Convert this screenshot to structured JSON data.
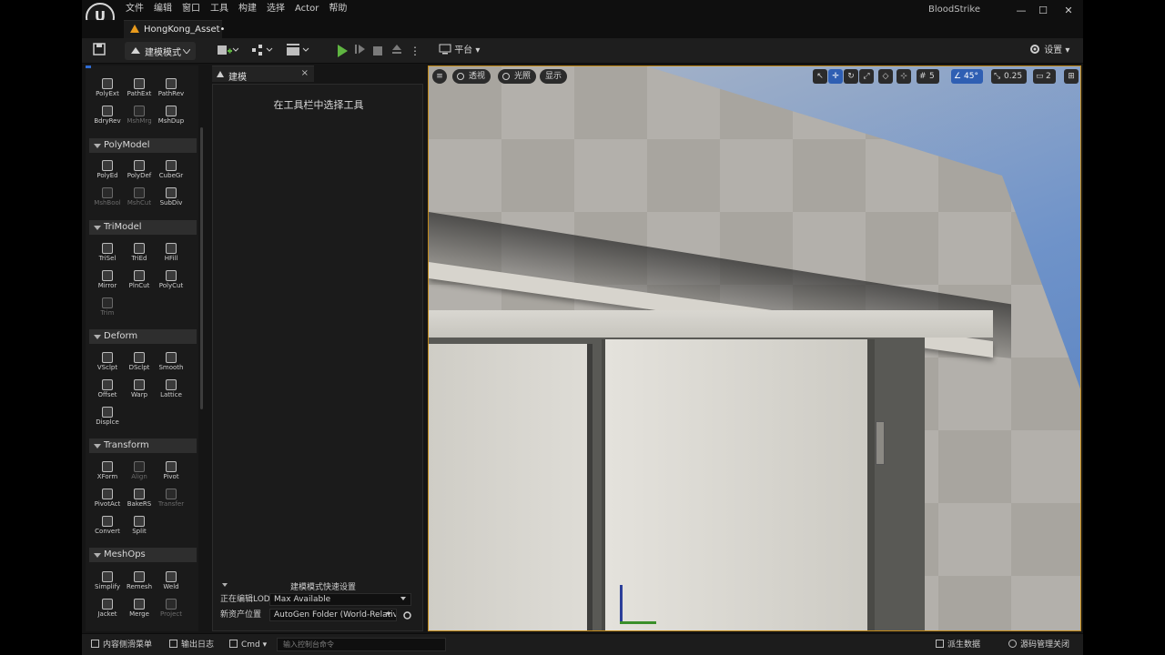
{
  "title_bar": {
    "logo": "U",
    "menu": [
      "文件",
      "编辑",
      "窗口",
      "工具",
      "构建",
      "选择",
      "Actor",
      "帮助"
    ],
    "app_name": "BloodStrike",
    "minimize": "—",
    "maximize": "☐",
    "close": "✕"
  },
  "asset_tab": {
    "label": "HongKong_Asset•"
  },
  "toolbar": {
    "mode_label": "建模模式",
    "platform_label": "平台",
    "settings_label": "设置"
  },
  "palette": {
    "categories": [
      "PolyModel",
      "TriModel",
      "Deform",
      "Transform",
      "MeshOps"
    ],
    "top_tools": [
      {
        "label": "PolyExt",
        "enabled": true
      },
      {
        "label": "PathExt",
        "enabled": true
      },
      {
        "label": "PathRev",
        "enabled": true
      },
      {
        "label": "BdryRev",
        "enabled": true
      },
      {
        "label": "MshMrg",
        "enabled": false
      },
      {
        "label": "MshDup",
        "enabled": true
      }
    ],
    "polymodel_tools": [
      {
        "label": "PolyEd",
        "enabled": true
      },
      {
        "label": "PolyDef",
        "enabled": true
      },
      {
        "label": "CubeGr",
        "enabled": true
      },
      {
        "label": "MshBool",
        "enabled": false
      },
      {
        "label": "MshCut",
        "enabled": false
      },
      {
        "label": "SubDiv",
        "enabled": true
      }
    ],
    "trimodel_tools": [
      {
        "label": "TriSel",
        "enabled": true
      },
      {
        "label": "TriEd",
        "enabled": true
      },
      {
        "label": "HFill",
        "enabled": true
      },
      {
        "label": "Mirror",
        "enabled": true
      },
      {
        "label": "PlnCut",
        "enabled": true
      },
      {
        "label": "PolyCut",
        "enabled": true
      },
      {
        "label": "Trim",
        "enabled": false
      }
    ],
    "deform_tools": [
      {
        "label": "VSclpt",
        "enabled": true
      },
      {
        "label": "DSclpt",
        "enabled": true
      },
      {
        "label": "Smooth",
        "enabled": true
      },
      {
        "label": "Offset",
        "enabled": true
      },
      {
        "label": "Warp",
        "enabled": true
      },
      {
        "label": "Lattice",
        "enabled": true
      },
      {
        "label": "Displce",
        "enabled": true
      }
    ],
    "transform_tools": [
      {
        "label": "XForm",
        "enabled": true
      },
      {
        "label": "Align",
        "enabled": false
      },
      {
        "label": "Pivot",
        "enabled": true
      },
      {
        "label": "PivotAct",
        "enabled": true
      },
      {
        "label": "BakeRS",
        "enabled": true
      },
      {
        "label": "Transfer",
        "enabled": false
      },
      {
        "label": "Convert",
        "enabled": true
      },
      {
        "label": "Split",
        "enabled": true
      }
    ],
    "meshops_tools": [
      {
        "label": "Simplify",
        "enabled": true
      },
      {
        "label": "Remesh",
        "enabled": true
      },
      {
        "label": "Weld",
        "enabled": true
      },
      {
        "label": "Jacket",
        "enabled": true
      },
      {
        "label": "Merge",
        "enabled": true
      },
      {
        "label": "Project",
        "enabled": false
      }
    ]
  },
  "details_panel": {
    "tab_label": "建模",
    "close": "×",
    "message": "在工具栏中选择工具",
    "quick_settings_title": "建模模式快速设置",
    "lod_label": "正在编辑LOD",
    "lod_value": "Max Available",
    "asset_location_label": "新资产位置",
    "asset_location_value": "AutoGen Folder (World-Relative)"
  },
  "viewport": {
    "perspective": "透视",
    "lighting": "光照",
    "show": "显示",
    "grid_snap": "5",
    "rotation_snap": "45°",
    "scale_snap": "0.25",
    "camera_speed": "2"
  },
  "status_bar": {
    "content_drawer": "内容侧滑菜单",
    "output_log": "输出日志",
    "cmd": "Cmd",
    "cmd_placeholder": "输入控制台命令",
    "derived_data": "派生数据",
    "source_control": "源码管理关闭"
  }
}
